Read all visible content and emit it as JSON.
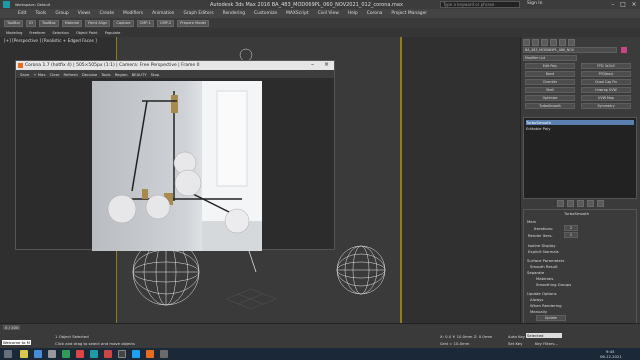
{
  "titlebar": {
    "workspace": "Workspace: Default",
    "title": "Autodesk 3ds Max 2016    BA_483_MOD069PL_060_NOV2021_012_corona.max",
    "search_placeholder": "Type a keyword or phrase",
    "signin": "Sign In"
  },
  "menu": [
    "Edit",
    "Tools",
    "Group",
    "Views",
    "Create",
    "Modifiers",
    "Animation",
    "Graph Editors",
    "Rendering",
    "Customize",
    "MAXScript",
    "Civil View",
    "Help",
    "Corona",
    "Project Manager"
  ],
  "toolbar": {
    "tabs": [
      "Modeling",
      "Freeform",
      "Selection",
      "Object Paint",
      "Populate"
    ],
    "buttons": [
      "ToolBar",
      "IO",
      "ToolBox",
      "Material",
      "Paint Align",
      "Capture",
      "CMP-1",
      "CMP-2",
      "Prepare Model"
    ]
  },
  "viewport": {
    "label": "[+] [Perspective ] [Realistic + Edged Faces ]"
  },
  "frame": {
    "title": "Corona 1.7 (hotfix 4) | 505×505px (1:1) | Camera: Free Perspective | Frame 0",
    "toolbar": [
      "Save",
      "+ Max",
      "Clear",
      "Refresh",
      "Denoise",
      "Tools",
      "Region",
      "BEAUTY",
      "Stop"
    ]
  },
  "panel": {
    "object_name": "BA_483_MOD069PL_060_NOV",
    "modifier_list": "Modifier List",
    "buttons": [
      "Edit Poly",
      "FFD 3x3x3",
      "Bend",
      "FFD(box)",
      "Chamfer",
      "Quad Cap Fix",
      "Shell",
      "Unwrap UVW",
      "Optimize",
      "UVW Map",
      "TurboSmooth",
      "Symmetry"
    ],
    "stack": [
      "TurboSmooth",
      "Editable Poly"
    ],
    "rollout": {
      "title": "TurboSmooth",
      "main": "Main",
      "iterations_label": "Iterations:",
      "iterations": "2",
      "render_iters_label": "Render Iters:",
      "render_iters": "2",
      "isoline": "Isoline Display",
      "explicit": "Explicit Normals",
      "surface": "Surface Parameters",
      "smooth_result": "Smooth Result",
      "separate": "Separate",
      "materials": "Materials",
      "smoothing_groups": "Smoothing Groups",
      "update": "Update Options",
      "always": "Always",
      "when_rendering": "When Rendering",
      "manually": "Manually",
      "update_btn": "Update"
    }
  },
  "status": {
    "frame": "0 / 100",
    "selected": "1 Object Selected",
    "hint": "Click and drag to select and move objects",
    "welcome": "Welcome to M",
    "coords": "X: 0.0  Y: 10.0mm  Z: 0.0mm",
    "grid": "Grid = 10.0mm",
    "autokey": "Auto Key",
    "selected_btn": "Selected",
    "setkey": "Set Key",
    "keyfilters": "Key Filters...",
    "time": "9:45",
    "date": "06.12.2021"
  }
}
